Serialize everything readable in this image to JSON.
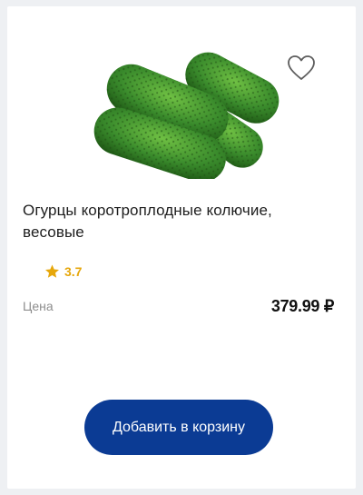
{
  "product": {
    "title": "Огурцы коротроплодные колючие, весовые",
    "rating": "3.7",
    "price_label": "Цена",
    "price": "379.99 ₽",
    "add_to_cart_label": "Добавить в корзину"
  },
  "icons": {
    "favorite": "heart-outline-icon",
    "rating": "star-icon"
  },
  "colors": {
    "accent": "#0b3b94",
    "rating": "#e6a70b",
    "cucumber": "#3f8f32"
  }
}
